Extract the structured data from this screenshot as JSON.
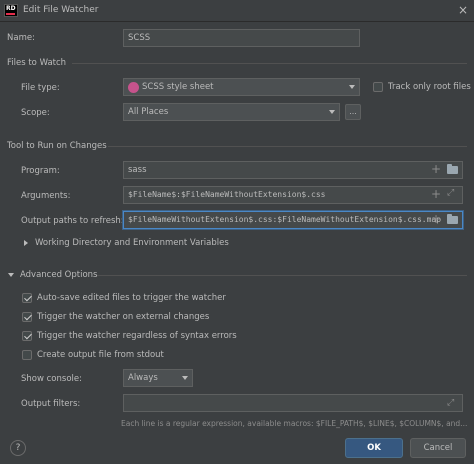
{
  "window": {
    "title": "Edit File Watcher",
    "close_glyph": "×",
    "logo_text": "RD"
  },
  "name": {
    "label": "Name:",
    "value": "SCSS"
  },
  "files_to_watch": {
    "section_title": "Files to Watch",
    "file_type_label": "File type:",
    "file_type_value": "SCSS style sheet",
    "file_type_icon": "scss-icon",
    "track_root_label": "Track only root files",
    "track_root_checked": false,
    "scope_label": "Scope:",
    "scope_value": "All Places",
    "scope_more": "..."
  },
  "tool": {
    "section_title": "Tool to Run on Changes",
    "program_label": "Program:",
    "program_value": "sass",
    "arguments_label": "Arguments:",
    "arguments_value": "$FileName$:$FileNameWithoutExtension$.css",
    "output_label": "Output paths to refresh:",
    "output_value": "$FileNameWithoutExtension$.css:$FileNameWithoutExtension$.css.map",
    "workdir_label": "Working Directory and Environment Variables",
    "plus_glyph": "+"
  },
  "advanced": {
    "section_title": "Advanced Options",
    "options": [
      {
        "label": "Auto-save edited files to trigger the watcher",
        "checked": true
      },
      {
        "label": "Trigger the watcher on external changes",
        "checked": true
      },
      {
        "label": "Trigger the watcher regardless of syntax errors",
        "checked": true
      },
      {
        "label": "Create output file from stdout",
        "checked": false
      }
    ],
    "show_console_label": "Show console:",
    "show_console_value": "Always",
    "output_filters_label": "Output filters:",
    "output_filters_value": "",
    "hint": "Each line is a regular expression, available macros: $FILE_PATH$, $LINE$, $COLUMN$, and..."
  },
  "footer": {
    "help_glyph": "?",
    "ok_label": "OK",
    "cancel_label": "Cancel"
  },
  "colors": {
    "background": "#3c3f41",
    "field": "#45494a",
    "primary": "#365880",
    "focus": "#4a88c7"
  }
}
